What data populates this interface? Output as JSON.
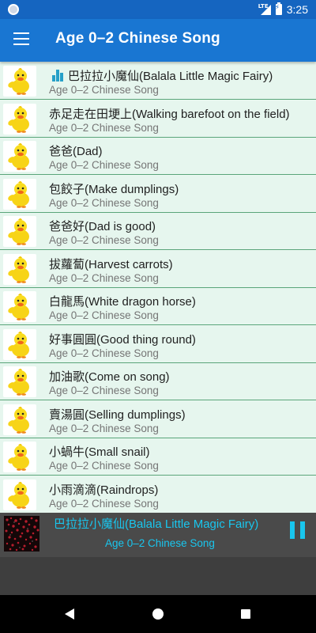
{
  "status_bar": {
    "network_label": "LTE",
    "time": "3:25"
  },
  "app_bar": {
    "title": "Age 0–2 Chinese Song",
    "menu_icon": "hamburger-menu-icon"
  },
  "song_list": {
    "thumbnail_icon": "yellow-duck-icon",
    "now_playing_icon": "equalizer-icon",
    "items": [
      {
        "title": "巴拉拉小魔仙(Balala Little Magic Fairy)",
        "subtitle": "Age 0–2 Chinese Song",
        "playing": true
      },
      {
        "title": "赤足走在田埂上(Walking barefoot on the field)",
        "subtitle": "Age 0–2 Chinese Song",
        "playing": false
      },
      {
        "title": "爸爸(Dad)",
        "subtitle": "Age 0–2 Chinese Song",
        "playing": false
      },
      {
        "title": "包餃子(Make dumplings)",
        "subtitle": "Age 0–2 Chinese Song",
        "playing": false
      },
      {
        "title": "爸爸好(Dad is good)",
        "subtitle": "Age 0–2 Chinese Song",
        "playing": false
      },
      {
        "title": "拔蘿蔔(Harvest carrots)",
        "subtitle": "Age 0–2 Chinese Song",
        "playing": false
      },
      {
        "title": "白龍馬(White dragon horse)",
        "subtitle": "Age 0–2 Chinese Song",
        "playing": false
      },
      {
        "title": "好事圓圓(Good thing round)",
        "subtitle": "Age 0–2 Chinese Song",
        "playing": false
      },
      {
        "title": "加油歌(Come on song)",
        "subtitle": "Age 0–2 Chinese Song",
        "playing": false
      },
      {
        "title": "賣湯圓(Selling dumplings)",
        "subtitle": "Age 0–2 Chinese Song",
        "playing": false
      },
      {
        "title": "小蝸牛(Small snail)",
        "subtitle": "Age 0–2 Chinese Song",
        "playing": false
      },
      {
        "title": "小雨滴滴(Raindrops)",
        "subtitle": "Age 0–2 Chinese Song",
        "playing": false
      }
    ]
  },
  "player": {
    "title": "巴拉拉小魔仙(Balala Little Magic Fairy)",
    "subtitle": "Age 0–2 Chinese Song",
    "state": "playing",
    "pause_icon": "pause-icon",
    "accent_color": "#19c6ee"
  },
  "nav_bar": {
    "back_icon": "back-triangle-icon",
    "home_icon": "home-circle-icon",
    "recents_icon": "recents-square-icon"
  },
  "colors": {
    "status_bar": "#1565c0",
    "app_bar": "#1976d2",
    "list_background": "#e6f6ee",
    "row_divider": "#5aa57a",
    "player_background": "#4a4a4a"
  }
}
